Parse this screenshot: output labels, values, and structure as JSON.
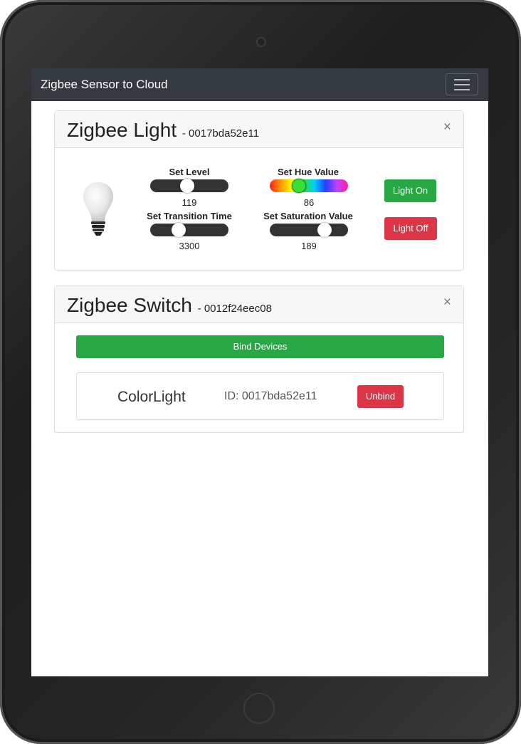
{
  "navbar": {
    "brand": "Zigbee Sensor to Cloud",
    "toggler_icon": "hamburger-menu-icon"
  },
  "light_card": {
    "title": "Zigbee Light",
    "device_id": "- 0017bda52e11",
    "close_symbol": "×",
    "bulb_icon": "light-bulb-icon",
    "controls": {
      "level": {
        "label": "Set Level",
        "value": "119",
        "fraction": 0.47
      },
      "transition": {
        "label": "Set Transition Time",
        "value": "3300",
        "fraction": 0.33
      },
      "hue": {
        "label": "Set Hue Value",
        "value": "86",
        "fraction": 0.34
      },
      "saturation": {
        "label": "Set Saturation Value",
        "value": "189",
        "fraction": 0.74
      }
    },
    "light_on_label": "Light On",
    "light_off_label": "Light Off"
  },
  "switch_card": {
    "title": "Zigbee Switch",
    "device_id": "- 0012f24eec08",
    "close_symbol": "×",
    "bind_label": "Bind Devices",
    "bound_device": {
      "name": "ColorLight",
      "id_text": "ID: 0017bda52e11",
      "unbind_label": "Unbind"
    }
  },
  "colors": {
    "navbar": "#343a40",
    "success": "#28a745",
    "danger": "#dc3545"
  }
}
